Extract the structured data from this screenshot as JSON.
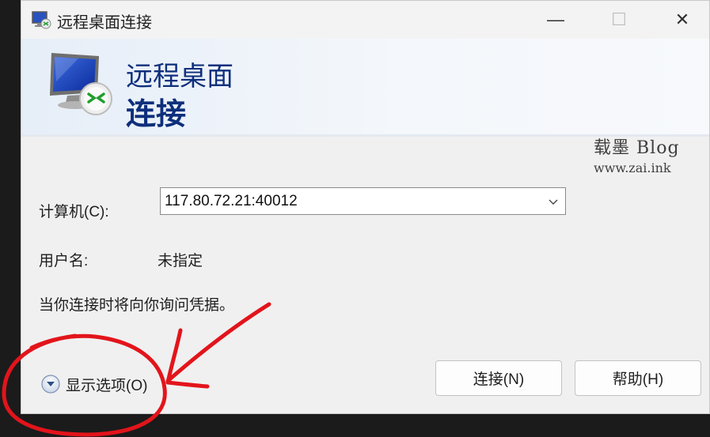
{
  "window": {
    "title": "远程桌面连接",
    "controls": {
      "minimize": "—",
      "maximize": "☐",
      "close": "✕"
    }
  },
  "banner": {
    "line1": "远程桌面",
    "line2": "连接"
  },
  "watermark": {
    "name": "载墨 Blog",
    "url": "www.zai.ink"
  },
  "form": {
    "computer_label": "计算机(C):",
    "computer_value": "117.80.72.21:40012",
    "username_label": "用户名:",
    "username_value": "未指定",
    "credentials_note": "当你连接时将向你询问凭据。"
  },
  "footer": {
    "show_options_label": "显示选项(O)",
    "connect_label": "连接(N)",
    "help_label": "帮助(H)"
  },
  "colors": {
    "banner_text": "#0e2f7c",
    "annotation": "#e3141b"
  },
  "icons": {
    "app": "remote-desktop-icon",
    "banner": "monitor-connect-icon",
    "combo": "chevron-down-icon",
    "options": "expand-circle-icon"
  }
}
